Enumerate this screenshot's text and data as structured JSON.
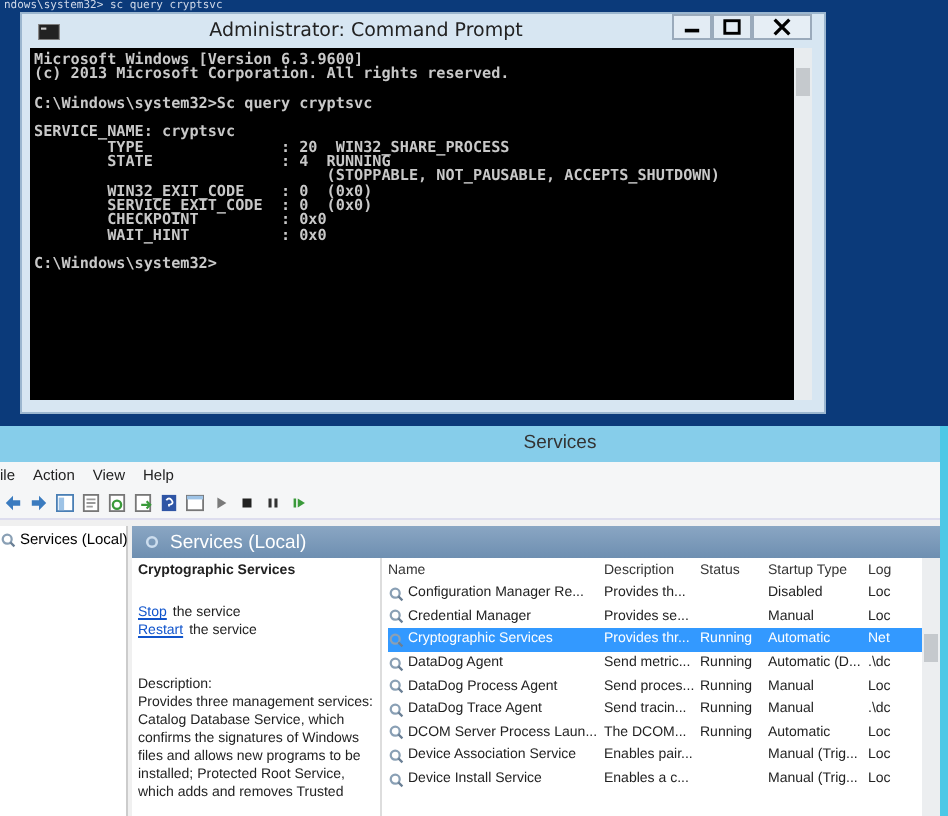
{
  "background_console": {
    "line": "ndows\\system32> sc query cryptsvc"
  },
  "command_prompt": {
    "title": "Administrator: Command Prompt",
    "blocks": [
      [
        "Microsoft Windows [Version 6.3.9600]",
        "(c) 2013 Microsoft Corporation. All rights reserved."
      ],
      [
        "C:\\Windows\\system32>Sc query cryptsvc"
      ],
      [
        "SERVICE_NAME: cryptsvc",
        "        TYPE               : 20  WIN32_SHARE_PROCESS",
        "        STATE              : 4  RUNNING",
        "                                (STOPPABLE, NOT_PAUSABLE, ACCEPTS_SHUTDOWN)",
        "        WIN32_EXIT_CODE    : 0  (0x0)",
        "        SERVICE_EXIT_CODE  : 0  (0x0)",
        "        CHECKPOINT         : 0x0",
        "        WAIT_HINT          : 0x0"
      ],
      [
        "C:\\Windows\\system32>"
      ]
    ]
  },
  "services": {
    "title": "Services",
    "menu": [
      "ile",
      "Action",
      "View",
      "Help"
    ],
    "tree": [
      "Services (Local)"
    ],
    "pane_title": "Services (Local)",
    "detail": {
      "name": "Cryptographic Services",
      "actions": [
        {
          "link": "Stop",
          "text": "the service"
        },
        {
          "link": "Restart",
          "text": "the service"
        }
      ],
      "description_label": "Description:",
      "description": "Provides three management services: Catalog Database Service, which confirms the signatures of Windows files and allows new programs to be installed; Protected Root Service, which adds and removes Trusted"
    },
    "table": {
      "columns": [
        "Name",
        "Description",
        "Status",
        "Startup Type",
        "Log"
      ],
      "rows": [
        {
          "cells": [
            "Configuration Manager Re...",
            "Provides th...",
            "",
            "Disabled",
            "Loc"
          ],
          "selected": false
        },
        {
          "cells": [
            "Credential Manager",
            "Provides se...",
            "",
            "Manual",
            "Loc"
          ],
          "selected": false
        },
        {
          "cells": [
            "Cryptographic Services",
            "Provides thr...",
            "Running",
            "Automatic",
            "Net"
          ],
          "selected": true
        },
        {
          "cells": [
            "DataDog Agent",
            "Send metric...",
            "Running",
            "Automatic (D...",
            ".\\dc"
          ],
          "selected": false
        },
        {
          "cells": [
            "DataDog Process Agent",
            "Send proces...",
            "Running",
            "Manual",
            "Loc"
          ],
          "selected": false
        },
        {
          "cells": [
            "DataDog Trace Agent",
            "Send tracin...",
            "Running",
            "Manual",
            ".\\dc"
          ],
          "selected": false
        },
        {
          "cells": [
            "DCOM Server Process Laun...",
            "The DCOM...",
            "Running",
            "Automatic",
            "Loc"
          ],
          "selected": false
        },
        {
          "cells": [
            "Device Association Service",
            "Enables pair...",
            "",
            "Manual (Trig...",
            "Loc"
          ],
          "selected": false
        },
        {
          "cells": [
            "Device Install Service",
            "Enables a c...",
            "",
            "Manual (Trig...",
            "Loc"
          ],
          "selected": false
        }
      ]
    }
  }
}
